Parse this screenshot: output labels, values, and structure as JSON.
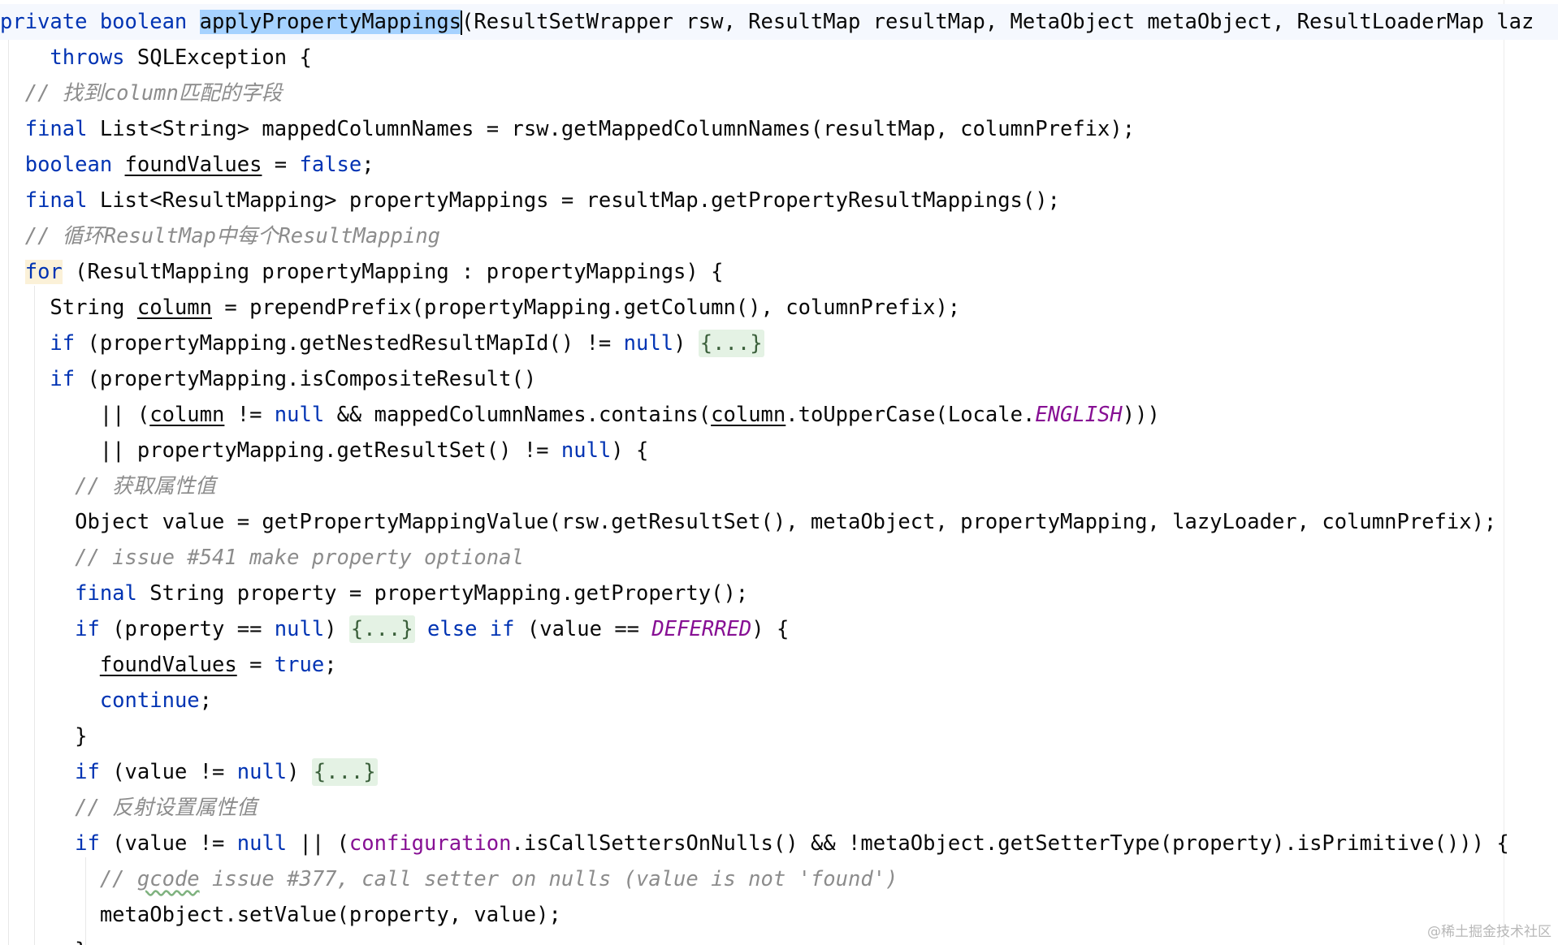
{
  "watermark": "@稀土掘金技术社区",
  "code": {
    "l1": {
      "kw1": "private boolean ",
      "method": "applyPropertyMappings",
      "rest": "(ResultSetWrapper rsw, ResultMap resultMap, MetaObject metaObject, ResultLoaderMap laz"
    },
    "l2": {
      "indent": "    ",
      "kw": "throws",
      "rest": " SQLException {"
    },
    "l3": {
      "indent": "  ",
      "comment": "// 找到column匹配的字段"
    },
    "l4": {
      "indent": "  ",
      "kw": "final",
      "rest": " List<String> mappedColumnNames = rsw.getMappedColumnNames(resultMap, columnPrefix);"
    },
    "l5": {
      "indent": "  ",
      "kw": "boolean",
      "sp": " ",
      "var": "foundValues",
      "mid": " = ",
      "kw2": "false",
      "end": ";"
    },
    "l6": {
      "indent": "  ",
      "kw": "final",
      "rest": " List<ResultMapping> propertyMappings = resultMap.getPropertyResultMappings();"
    },
    "l7": {
      "indent": "  ",
      "comment": "// 循环ResultMap中每个ResultMapping"
    },
    "l8": {
      "indent": "  ",
      "kw": "for",
      "rest": " (ResultMapping propertyMapping : propertyMappings) {"
    },
    "l9": {
      "indent": "    ",
      "pre": "String ",
      "var": "column",
      "rest": " = prependPrefix(propertyMapping.getColumn(), columnPrefix);"
    },
    "l10": {
      "indent": "    ",
      "kw": "if",
      "mid": " (propertyMapping.getNestedResultMapId() != ",
      "kw2": "null",
      "close": ") ",
      "fold": "{...}"
    },
    "l11": {
      "indent": "    ",
      "kw": "if",
      "rest": " (propertyMapping.isCompositeResult()"
    },
    "l12": {
      "indent": "        ",
      "pre": "|| (",
      "var": "column",
      "mid": " != ",
      "kw": "null",
      "mid2": " && mappedColumnNames.contains(",
      "var2": "column",
      "mid3": ".toUpperCase(Locale.",
      "static": "ENGLISH",
      "end": ")))"
    },
    "l13": {
      "indent": "        ",
      "pre": "|| propertyMapping.getResultSet() != ",
      "kw": "null",
      "end": ") {"
    },
    "l14": {
      "indent": "      ",
      "comment": "// 获取属性值"
    },
    "l15": {
      "indent": "      ",
      "rest": "Object value = getPropertyMappingValue(rsw.getResultSet(), metaObject, propertyMapping, lazyLoader, columnPrefix);"
    },
    "l16": {
      "indent": "      ",
      "comment": "// issue #541 make property optional"
    },
    "l17": {
      "indent": "      ",
      "kw": "final",
      "rest": " String property = propertyMapping.getProperty();"
    },
    "l18": {
      "indent": "      ",
      "kw": "if",
      "mid": " (property == ",
      "kw2": "null",
      "close": ") ",
      "fold": "{...}",
      "sp": " ",
      "kw3": "else if",
      "mid2": " (value == ",
      "static": "DEFERRED",
      "end": ") {"
    },
    "l19": {
      "indent": "        ",
      "var": "foundValues",
      "mid": " = ",
      "kw": "true",
      "end": ";"
    },
    "l20": {
      "indent": "        ",
      "kw": "continue",
      "end": ";"
    },
    "l21": {
      "indent": "      ",
      "rest": "}"
    },
    "l22": {
      "indent": "      ",
      "kw": "if",
      "mid": " (value != ",
      "kw2": "null",
      "close": ") ",
      "fold": "{...}"
    },
    "l23": {
      "indent": "      ",
      "comment": "// 反射设置属性值"
    },
    "l24": {
      "indent": "      ",
      "kw": "if",
      "mid": " (value != ",
      "kw2": "null",
      "mid2": " || (",
      "field": "configuration",
      "end": ".isCallSettersOnNulls() && !metaObject.getSetterType(property).isPrimitive())) {"
    },
    "l25": {
      "indent": "        ",
      "c1": "// ",
      "wavy": "gcode",
      "c2": " issue #377, call setter on nulls (value is not 'found')"
    },
    "l26": {
      "indent": "        ",
      "rest": "metaObject.setValue(property, value);"
    },
    "l27": {
      "indent": "      ",
      "rest": "}"
    }
  }
}
